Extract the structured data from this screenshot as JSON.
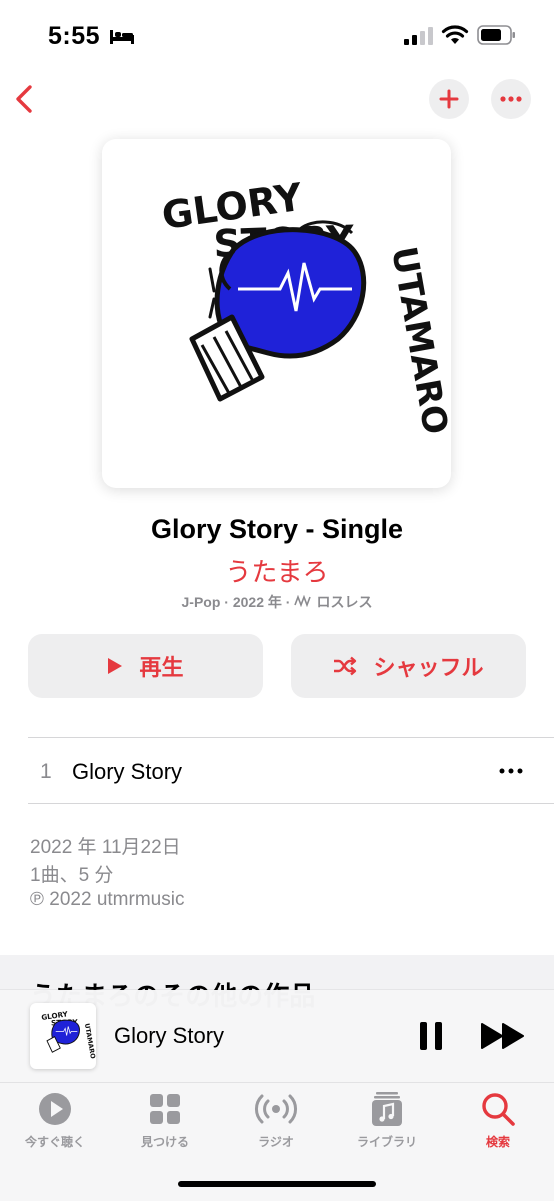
{
  "status_bar": {
    "time": "5:55"
  },
  "album": {
    "title": "Glory Story - Single",
    "artist": "うたまろ",
    "genre": "J-Pop",
    "year": "2022 年",
    "lossless": "ロスレス",
    "artwork_text": [
      "GLORY",
      "STORY",
      "UTAMARO"
    ]
  },
  "actions": {
    "play": "再生",
    "shuffle": "シャッフル"
  },
  "tracks": [
    {
      "number": "1",
      "title": "Glory Story"
    }
  ],
  "details": {
    "release_date": "2022 年 11月22日",
    "summary": "1曲、5 分",
    "copyright": "℗ 2022 utmrmusic"
  },
  "more_section": {
    "title": "うたまろのその他の作品"
  },
  "now_playing": {
    "title": "Glory Story"
  },
  "tabs": [
    {
      "label": "今すぐ聴く",
      "icon": "play-circle-icon"
    },
    {
      "label": "見つける",
      "icon": "grid-icon"
    },
    {
      "label": "ラジオ",
      "icon": "radio-icon"
    },
    {
      "label": "ライブラリ",
      "icon": "library-icon"
    },
    {
      "label": "検索",
      "icon": "search-icon"
    }
  ],
  "colors": {
    "accent": "#e5393f",
    "secondary_text": "#8a8a8e",
    "button_bg": "#eeeeef"
  }
}
